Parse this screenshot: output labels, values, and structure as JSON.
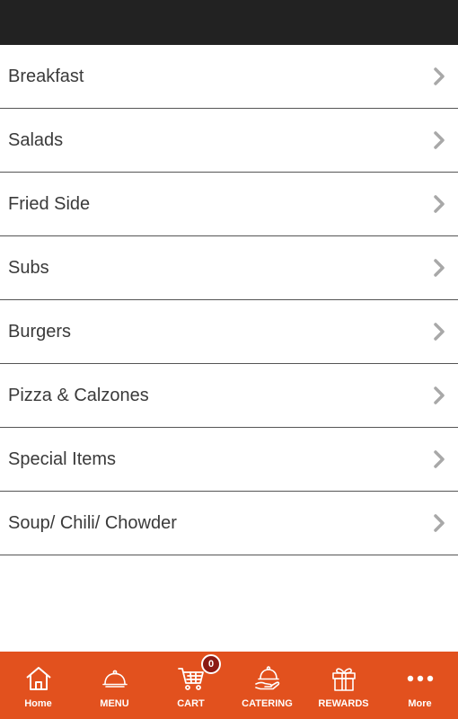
{
  "menu": {
    "items": [
      {
        "label": "Breakfast"
      },
      {
        "label": "Salads"
      },
      {
        "label": "Fried Side"
      },
      {
        "label": "Subs"
      },
      {
        "label": "Burgers"
      },
      {
        "label": "Pizza & Calzones"
      },
      {
        "label": "Special Items"
      },
      {
        "label": "Soup/ Chili/ Chowder"
      }
    ]
  },
  "tabbar": {
    "home": "Home",
    "menu": "MENU",
    "cart": "CART",
    "cart_count": "0",
    "catering": "CATERING",
    "rewards": "REWARDS",
    "more": "More"
  },
  "colors": {
    "topbar": "#222222",
    "tabbar": "#e2511e",
    "badge": "#8c1a14"
  }
}
